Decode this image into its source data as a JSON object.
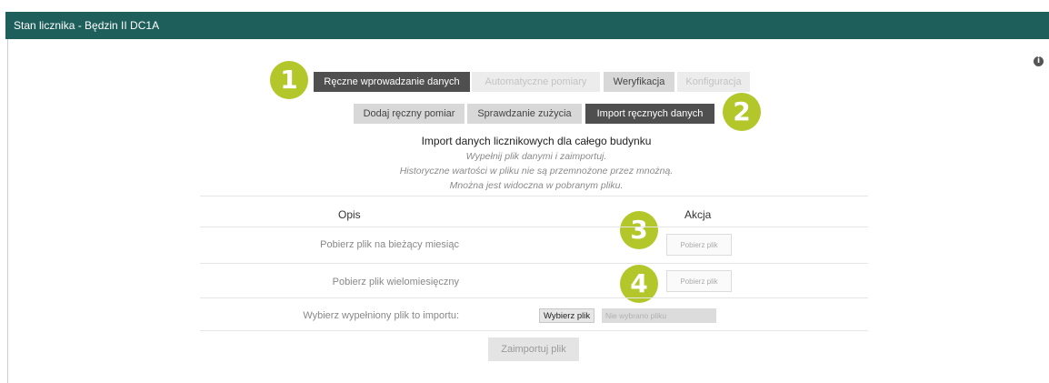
{
  "window": {
    "title": "Stan licznika - Będzin II DC1A"
  },
  "tabs_main": [
    {
      "label": "Ręczne wprowadzanie danych",
      "state": "active"
    },
    {
      "label": "Automatyczne pomiary",
      "state": "disabled"
    },
    {
      "label": "Weryfikacja",
      "state": "normal"
    },
    {
      "label": "Konfiguracja",
      "state": "disabled"
    }
  ],
  "tabs_sub": [
    {
      "label": "Dodaj ręczny pomiar",
      "state": "normal"
    },
    {
      "label": "Sprawdzanie zużycia",
      "state": "normal"
    },
    {
      "label": "Import ręcznych danych",
      "state": "active"
    }
  ],
  "badges": [
    "1",
    "2",
    "3",
    "4"
  ],
  "import": {
    "heading": "Import danych licznikowych dla całego budynku",
    "notes": [
      "Wypełnij plik danymi i zaimportuj.",
      "Historyczne wartości w pliku nie są przemnożone przez mnożną.",
      "Mnożna jest widoczna w pobranym pliku."
    ]
  },
  "table": {
    "col_description": "Opis",
    "col_action": "Akcja",
    "rows": [
      {
        "label": "Pobierz plik na bieżący miesiąc",
        "button": "Pobierz plik"
      },
      {
        "label": "Pobierz plik wielomiesięczny",
        "button": "Pobierz plik"
      }
    ],
    "file_row": {
      "label": "Wybierz wypełniony plik to importu:",
      "choose_button": "Wybierz plik",
      "status": "Nie wybrano pliku"
    },
    "import_button": "Zaimportuj plik"
  },
  "icons": {
    "info": "info-icon"
  },
  "colors": {
    "header": "#1f5f5b",
    "badge": "#b3c72b",
    "active_tab": "#4f4f4f"
  }
}
